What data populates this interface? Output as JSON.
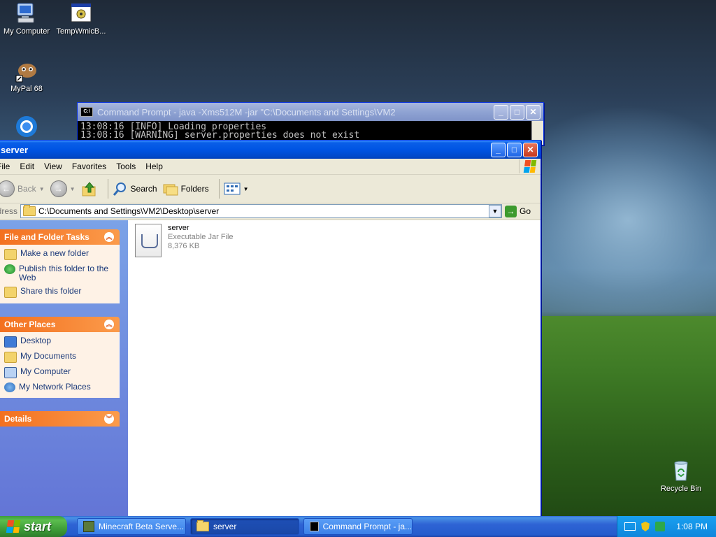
{
  "desktop": {
    "icons": [
      {
        "label": "My Computer",
        "icon": "my-computer-icon"
      },
      {
        "label": "TempWmicB...",
        "icon": "wmic-icon"
      },
      {
        "label": "MyPal 68",
        "icon": "mypal-icon"
      },
      {
        "label": "Recycle Bin",
        "icon": "recycle-bin-icon"
      }
    ]
  },
  "cmd_window": {
    "title": "Command Prompt - java -Xms512M -jar \"C:\\Documents and Settings\\VM2",
    "lines": [
      "13:08:16 [INFO] Loading properties",
      "13:08:16 [WARNING] server.properties does not exist"
    ]
  },
  "explorer": {
    "title": "server",
    "menu": [
      "File",
      "Edit",
      "View",
      "Favorites",
      "Tools",
      "Help"
    ],
    "toolbar": {
      "back": "Back",
      "search": "Search",
      "folders": "Folders"
    },
    "address": {
      "label": "Address",
      "value": "C:\\Documents and Settings\\VM2\\Desktop\\server",
      "go": "Go"
    },
    "file_tasks": {
      "title": "File and Folder Tasks",
      "items": [
        "Make a new folder",
        "Publish this folder to the Web",
        "Share this folder"
      ]
    },
    "other_places": {
      "title": "Other Places",
      "items": [
        "Desktop",
        "My Documents",
        "My Computer",
        "My Network Places"
      ]
    },
    "details": {
      "title": "Details"
    },
    "files": [
      {
        "name": "server",
        "type": "Executable Jar File",
        "size": "8,376 KB"
      }
    ]
  },
  "taskbar": {
    "start": "start",
    "buttons": [
      {
        "label": "Minecraft Beta Serve...",
        "icon": "minecraft-icon"
      },
      {
        "label": "server",
        "icon": "folder-icon",
        "active": true
      },
      {
        "label": "Command Prompt - ja...",
        "icon": "cmd-icon"
      }
    ],
    "clock": "1:08 PM"
  }
}
